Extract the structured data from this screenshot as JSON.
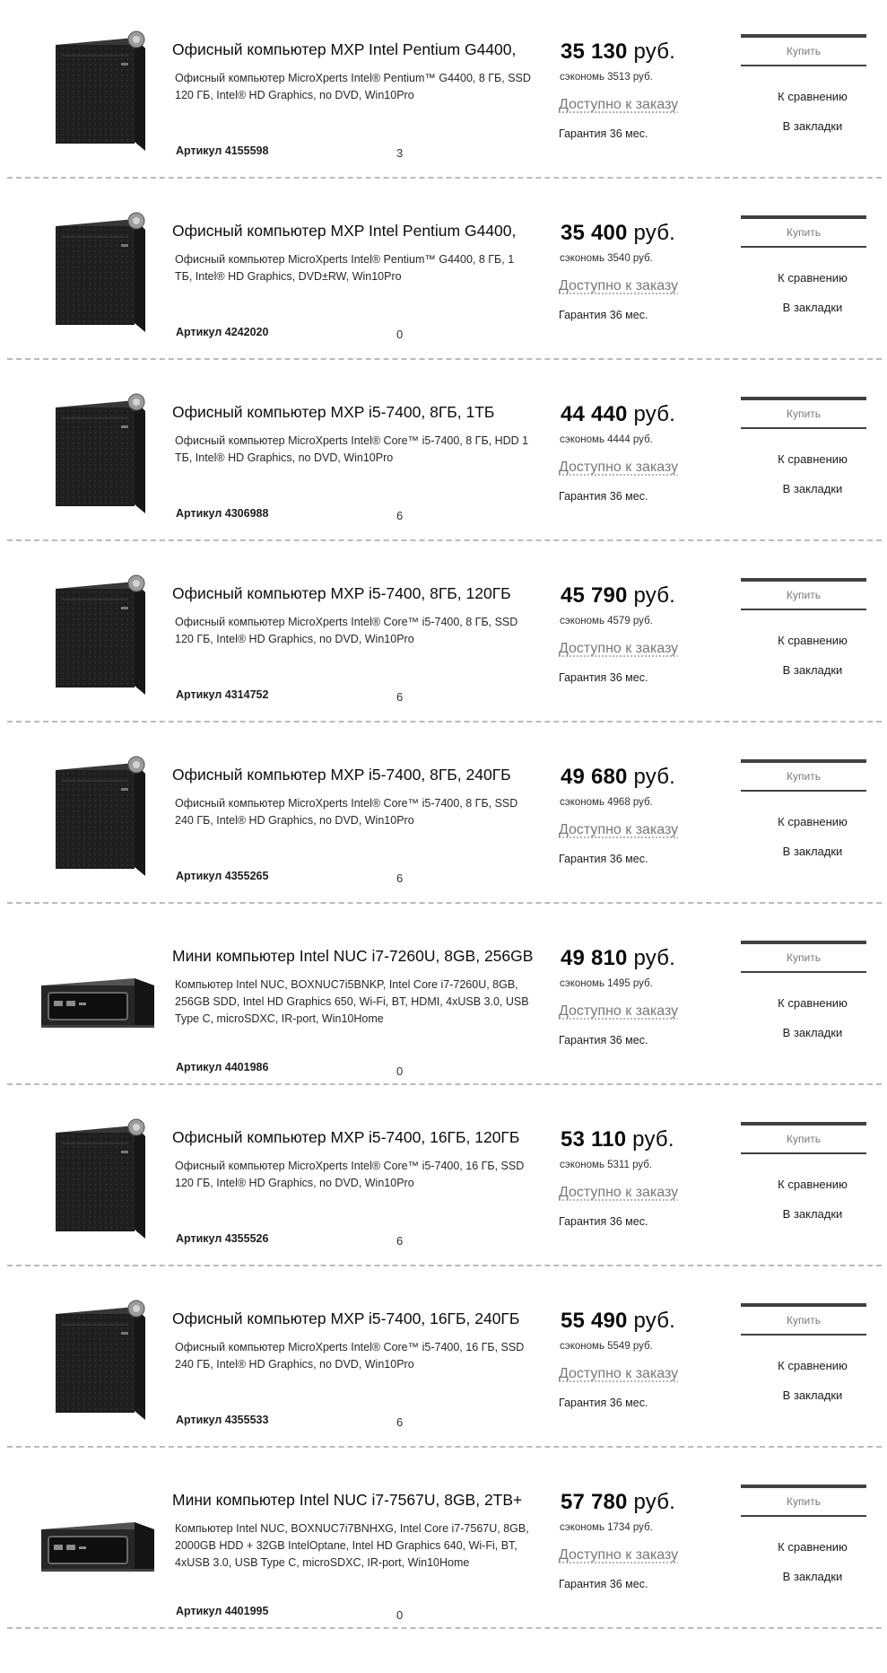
{
  "products": [
    {
      "type": "tower",
      "title": "Офисный компьютер MXP Intel Pentium G4400,",
      "description": "Офисный компьютер MicroXperts Intel® Pentium™ G4400, 8 ГБ, SSD 120 ГБ, Intel® HD Graphics, no DVD, Win10Pro",
      "article": "Артикул 4155598",
      "qty": "3",
      "price": "35 130",
      "currency": "руб.",
      "savings": "сэкономь 3513 руб.",
      "availability": "Доступно к заказу",
      "warranty": "Гарантия 36 мес.",
      "buy_label": "Купить",
      "compare_label": "К сравнению",
      "bookmark_label": "В закладки"
    },
    {
      "type": "tower",
      "title": "Офисный компьютер MXP Intel Pentium G4400,",
      "description": "Офисный компьютер MicroXperts Intel® Pentium™ G4400, 8 ГБ, 1 ТБ, Intel® HD Graphics, DVD±RW, Win10Pro",
      "article": "Артикул 4242020",
      "qty": "0",
      "price": "35 400",
      "currency": "руб.",
      "savings": "сэкономь 3540 руб.",
      "availability": "Доступно к заказу",
      "warranty": "Гарантия 36 мес.",
      "buy_label": "Купить",
      "compare_label": "К сравнению",
      "bookmark_label": "В закладки"
    },
    {
      "type": "tower",
      "title": "Офисный компьютер MXP i5-7400, 8ГБ, 1ТБ",
      "description": "Офисный компьютер MicroXperts Intel® Core™ i5-7400, 8 ГБ, HDD 1 ТБ, Intel® HD Graphics, no DVD, Win10Pro",
      "article": "Артикул 4306988",
      "qty": "6",
      "price": "44 440",
      "currency": "руб.",
      "savings": "сэкономь 4444 руб.",
      "availability": "Доступно к заказу",
      "warranty": "Гарантия 36 мес.",
      "buy_label": "Купить",
      "compare_label": "К сравнению",
      "bookmark_label": "В закладки"
    },
    {
      "type": "tower",
      "title": "Офисный компьютер MXP i5-7400, 8ГБ, 120ГБ",
      "description": "Офисный компьютер MicroXperts Intel® Core™ i5-7400, 8 ГБ, SSD 120 ГБ, Intel® HD Graphics, no DVD, Win10Pro",
      "article": "Артикул 4314752",
      "qty": "6",
      "price": "45 790",
      "currency": "руб.",
      "savings": "сэкономь 4579 руб.",
      "availability": "Доступно к заказу",
      "warranty": "Гарантия 36 мес.",
      "buy_label": "Купить",
      "compare_label": "К сравнению",
      "bookmark_label": "В закладки"
    },
    {
      "type": "tower",
      "title": "Офисный компьютер MXP i5-7400, 8ГБ, 240ГБ",
      "description": "Офисный компьютер MicroXperts Intel® Core™ i5-7400, 8 ГБ, SSD 240 ГБ, Intel® HD Graphics, no DVD, Win10Pro",
      "article": "Артикул 4355265",
      "qty": "6",
      "price": "49 680",
      "currency": "руб.",
      "savings": "сэкономь 4968 руб.",
      "availability": "Доступно к заказу",
      "warranty": "Гарантия 36 мес.",
      "buy_label": "Купить",
      "compare_label": "К сравнению",
      "bookmark_label": "В закладки"
    },
    {
      "type": "nuc",
      "title": "Мини компьютер Intel NUC i7-7260U, 8GB, 256GB",
      "description": "Компьютер Intel NUC, BOXNUC7i5BNKP, Intel Core i7-7260U, 8GB, 256GB SDD, Intel HD Graphics 650, Wi-Fi, BT, HDMI, 4xUSB 3.0, USB Type C, microSDXC, IR-port, Win10Home",
      "article": "Артикул 4401986",
      "qty": "0",
      "price": "49 810",
      "currency": "руб.",
      "savings": "сэкономь 1495 руб.",
      "availability": "Доступно к заказу",
      "warranty": "Гарантия 36 мес.",
      "buy_label": "Купить",
      "compare_label": "К сравнению",
      "bookmark_label": "В закладки"
    },
    {
      "type": "tower",
      "title": "Офисный компьютер MXP i5-7400, 16ГБ, 120ГБ",
      "description": "Офисный компьютер MicroXperts Intel® Core™ i5-7400, 16 ГБ, SSD 120 ГБ, Intel® HD Graphics, no DVD, Win10Pro",
      "article": "Артикул 4355526",
      "qty": "6",
      "price": "53 110",
      "currency": "руб.",
      "savings": "сэкономь 5311 руб.",
      "availability": "Доступно к заказу",
      "warranty": "Гарантия 36 мес.",
      "buy_label": "Купить",
      "compare_label": "К сравнению",
      "bookmark_label": "В закладки"
    },
    {
      "type": "tower",
      "title": "Офисный компьютер MXP i5-7400, 16ГБ, 240ГБ",
      "description": "Офисный компьютер MicroXperts Intel® Core™ i5-7400, 16 ГБ, SSD 240 ГБ, Intel® HD Graphics, no DVD, Win10Pro",
      "article": "Артикул 4355533",
      "qty": "6",
      "price": "55 490",
      "currency": "руб.",
      "savings": "сэкономь 5549 руб.",
      "availability": "Доступно к заказу",
      "warranty": "Гарантия 36 мес.",
      "buy_label": "Купить",
      "compare_label": "К сравнению",
      "bookmark_label": "В закладки"
    },
    {
      "type": "nuc",
      "title": "Мини компьютер Intel NUC i7-7567U, 8GB, 2TB+",
      "description": "Компьютер Intel NUC, BOXNUC7i7BNHXG, Intel Core i7-7567U, 8GB, 2000GB HDD + 32GB IntelOptane, Intel HD Graphics 640, Wi-Fi, BT, 4xUSB 3.0, USB Type C, microSDXC, IR-port, Win10Home",
      "article": "Артикул 4401995",
      "qty": "0",
      "price": "57 780",
      "currency": "руб.",
      "savings": "сэкономь 1734 руб.",
      "availability": "Доступно к заказу",
      "warranty": "Гарантия 36 мес.",
      "buy_label": "Купить",
      "compare_label": "К сравнению",
      "bookmark_label": "В закладки"
    }
  ]
}
